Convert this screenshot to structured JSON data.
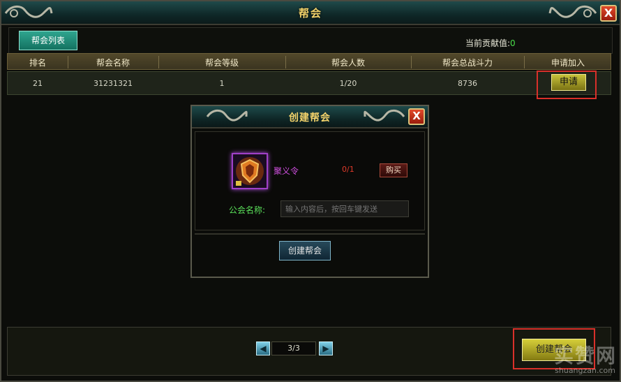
{
  "window": {
    "title": "帮会",
    "close_glyph": "X"
  },
  "tabs": [
    {
      "label": "帮会列表",
      "active": true
    }
  ],
  "contribution": {
    "label": "当前贡献值:",
    "value": "0"
  },
  "table": {
    "columns": [
      "排名",
      "帮会名称",
      "帮会等级",
      "帮会人数",
      "帮会总战斗力",
      "申请加入"
    ],
    "rows": [
      {
        "rank": "21",
        "name": "31231321",
        "level": "1",
        "members": "1/20",
        "power": "8736",
        "action": "申请"
      }
    ]
  },
  "dialog": {
    "title": "创建帮会",
    "close_glyph": "X",
    "item": {
      "name": "聚义令",
      "count": "0/1",
      "buy_label": "购买",
      "icon": "shield-badge-icon",
      "locked": true
    },
    "name_label": "公会名称:",
    "name_placeholder": "输入内容后，按回车键发送",
    "create_label": "创建帮会"
  },
  "pagination": {
    "prev_glyph": "◀",
    "next_glyph": "▶",
    "page": "3/3"
  },
  "footer": {
    "create_label": "创建帮会"
  },
  "watermark": {
    "text": "实赞网",
    "url": "shuangzan.com"
  },
  "colors": {
    "title_gold": "#f3d36b",
    "highlight_red": "#d9302a",
    "contribution_green": "#4adf4a"
  }
}
